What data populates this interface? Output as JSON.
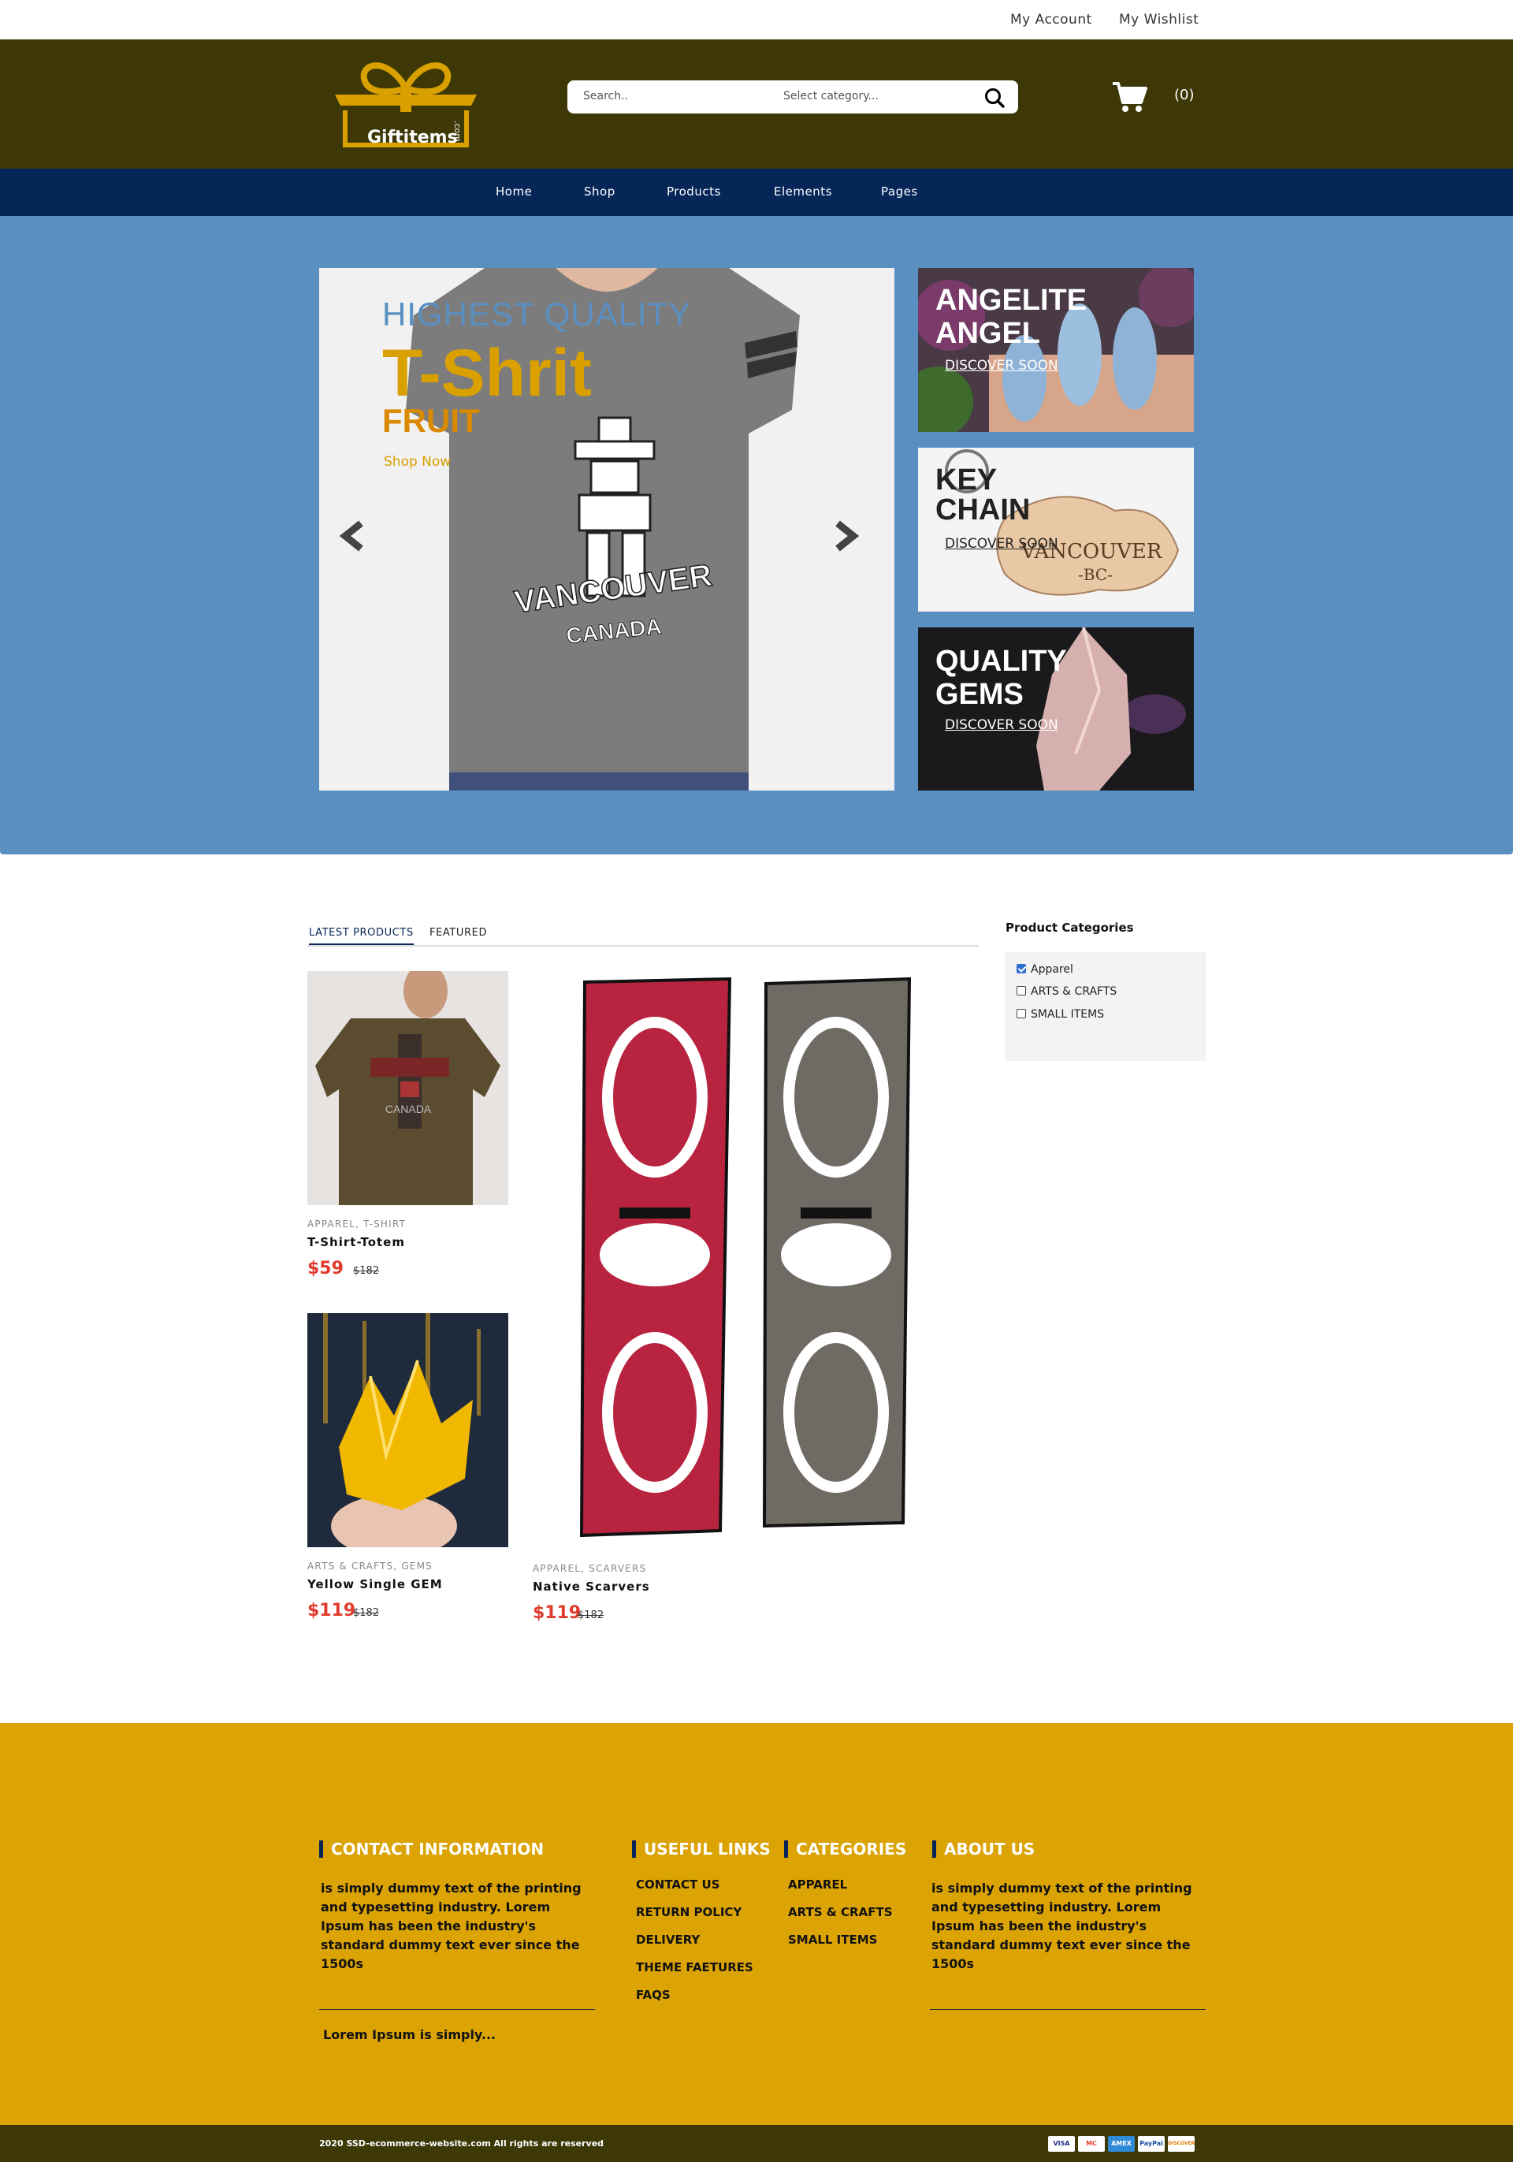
{
  "topbar": {
    "account": "My Account",
    "wishlist": "My Wishlist"
  },
  "header": {
    "logo_text": "Giftitems",
    "logo_suffix": ".com",
    "search_placeholder": "Search..",
    "category_placeholder": "Select category...",
    "cart_count": "(0)"
  },
  "nav": [
    "Home",
    "Shop",
    "Products",
    "Elements",
    "Pages"
  ],
  "hero": {
    "line1": "HIGHEST QUALITY",
    "line2": "T-Shrit",
    "line3": "FRUIT",
    "cta": "Shop Now"
  },
  "promos": [
    {
      "title1": "ANGELITE",
      "title2": "ANGEL",
      "link": "DISCOVER SOON"
    },
    {
      "title1": "KEY",
      "title2": "CHAIN",
      "link": "DISCOVER SOON"
    },
    {
      "title1": "QUALITY",
      "title2": "GEMS",
      "link": "DISCOVER SOON"
    }
  ],
  "tabs": {
    "latest": "LATEST PRODUCTS",
    "featured": "FEATURED"
  },
  "products": [
    {
      "category": "APPAREL, T-SHIRT",
      "name": "T-Shirt-Totem",
      "price": "$59",
      "old_price": "$182"
    },
    {
      "category": "ARTS & CRAFTS, GEMS",
      "name": "Yellow Single GEM",
      "price": "$119",
      "old_price": "$182"
    },
    {
      "category": "APPAREL, SCARVERS",
      "name": "Native Scarvers",
      "price": "$119",
      "old_price": "$182"
    }
  ],
  "sidebar": {
    "title": "Product Categories",
    "items": [
      {
        "label": "Apparel",
        "checked": true
      },
      {
        "label": "ARTS & CRAFTS",
        "checked": false
      },
      {
        "label": "SMALL ITEMS",
        "checked": false
      }
    ]
  },
  "footer": {
    "contact": {
      "heading": "CONTACT INFORMATION",
      "text": "is simply dummy text of the printing and typesetting industry. Lorem Ipsum has been the industry's standard dummy text ever since the 1500s",
      "sub": "Lorem Ipsum is simply..."
    },
    "useful": {
      "heading": "USEFUL LINKS",
      "links": [
        "CONTACT US",
        "RETURN POLICY",
        "DELIVERY",
        "THEME FAETURES",
        "FAQS"
      ]
    },
    "categories": {
      "heading": "CATEGORIES",
      "links": [
        "APPAREL",
        "ARTS & CRAFTS",
        "SMALL ITEMS"
      ]
    },
    "about": {
      "heading": "ABOUT US",
      "text": "is simply dummy text of the printing and typesetting industry. Lorem Ipsum has been the industry's standard dummy text ever since the 1500s"
    },
    "copyright": "2020 SSD-ecommerce-website.com All rights are reserved",
    "payment_icons": [
      "VISA",
      "MC",
      "AMEX",
      "PayPal",
      "DISCOVER"
    ]
  },
  "colors": {
    "header_bg": "#3d3806",
    "nav_bg": "#062657",
    "hero_bg": "#5a8fc2",
    "footer_bg": "#dba304",
    "price_red": "#e23b2e",
    "accent_gold": "#d9a000"
  }
}
